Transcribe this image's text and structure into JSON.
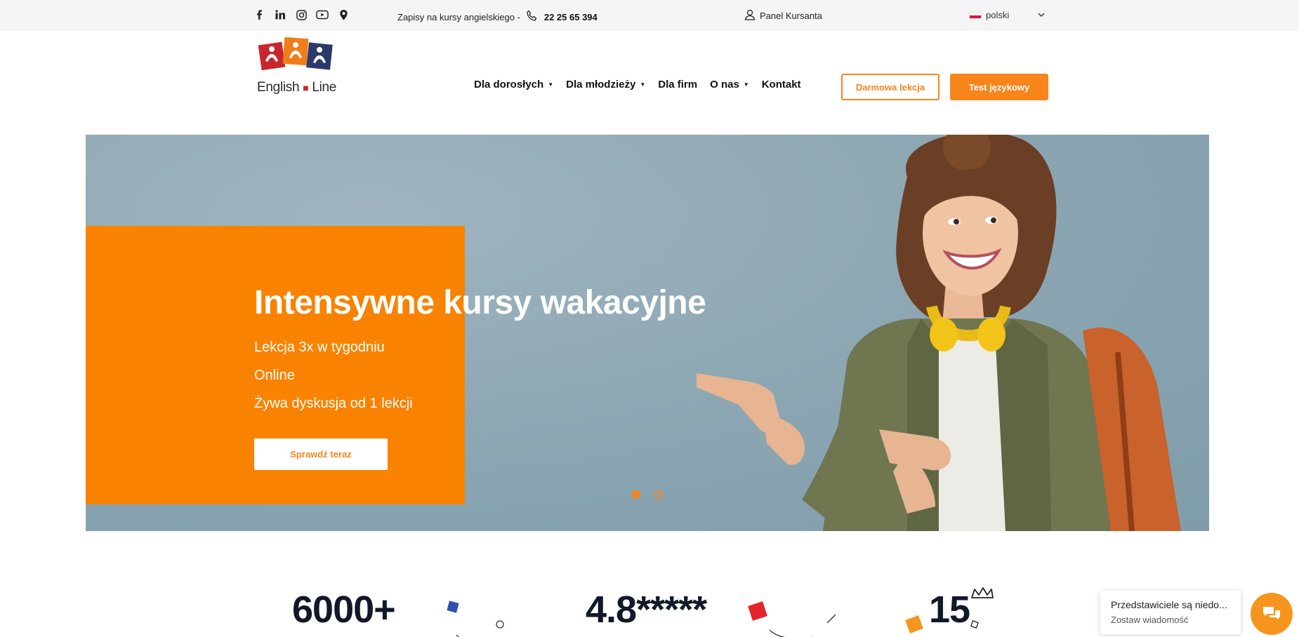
{
  "topbar": {
    "social_icons": [
      "facebook-icon",
      "linkedin-icon",
      "instagram-icon",
      "youtube-icon",
      "location-pin-icon"
    ],
    "enroll_text": "Zapisy na kursy angielskiego -",
    "phone": "22 25 65 394",
    "panel_label": "Panel Kursanta",
    "language": "polski"
  },
  "logo": {
    "word_left": "English",
    "word_right": "Line"
  },
  "nav": {
    "items": [
      {
        "label": "Dla dorosłych",
        "has_dropdown": true
      },
      {
        "label": "Dla młodzieży",
        "has_dropdown": true
      },
      {
        "label": "Dla firm",
        "has_dropdown": false
      },
      {
        "label": "O nas",
        "has_dropdown": true
      },
      {
        "label": "Kontakt",
        "has_dropdown": false
      }
    ],
    "free_lesson": "Darmowa lekcja",
    "test": "Test językowy"
  },
  "hero": {
    "title": "Intensywne kursy wakacyjne",
    "lines": [
      "Lekcja 3x w tygodniu",
      "Online",
      "Żywa dyskusja od 1 lekcji"
    ],
    "cta": "Sprawdź teraz",
    "slides": 2,
    "active_slide": 1
  },
  "stats": [
    "6000+",
    "4.8*****",
    "15"
  ],
  "chat": {
    "title": "Przedstawiciele są niedo...",
    "subtitle": "Zostaw wiadomość"
  },
  "colors": {
    "accent": "#f7851b",
    "hero_orange": "#f98200",
    "hero_bg": "#8ea8b4",
    "topbar_bg": "#f5f5f7"
  }
}
